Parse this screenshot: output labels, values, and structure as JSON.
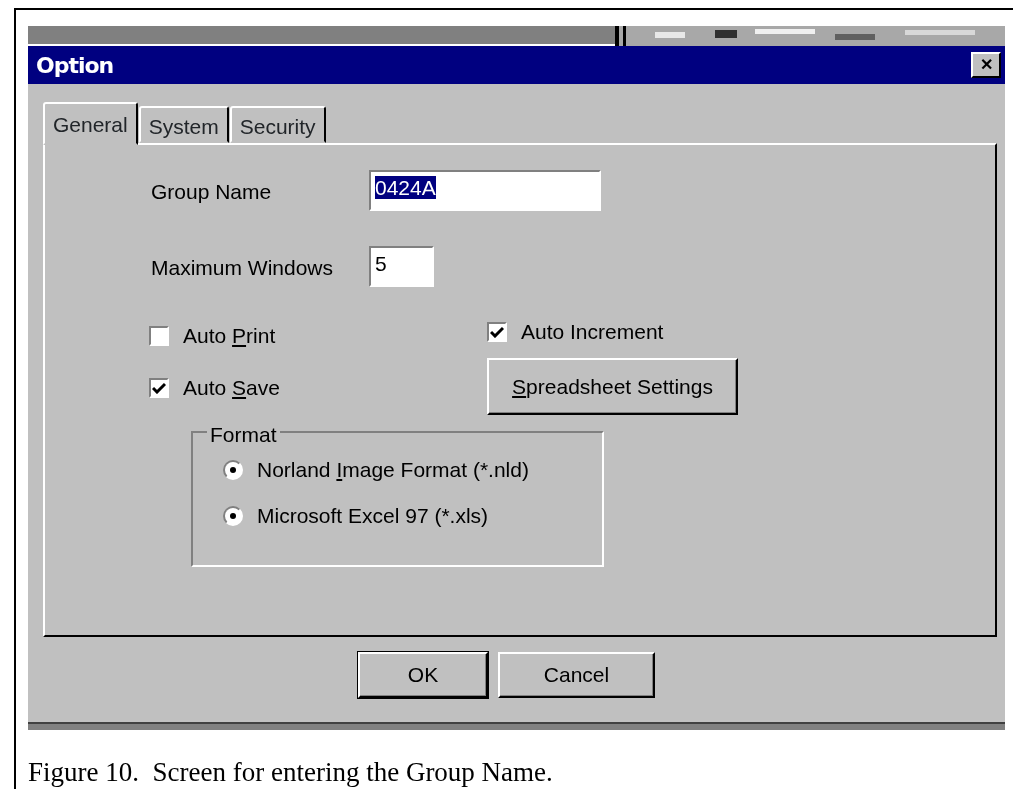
{
  "window": {
    "title": "Option",
    "close": "✕"
  },
  "tabs": [
    {
      "label": "General",
      "selected": true
    },
    {
      "label": "System",
      "selected": false
    },
    {
      "label": "Security",
      "selected": false
    }
  ],
  "fields": [
    {
      "label": "Group Name",
      "value": "0424A",
      "highlighted": true,
      "kind": "wide"
    },
    {
      "label": "Maximum Windows",
      "value": "5",
      "highlighted": false,
      "kind": "narrow"
    }
  ],
  "checkboxes_left": [
    {
      "before": "Auto ",
      "key": "P",
      "after": "rint",
      "checked": false
    },
    {
      "before": "Auto ",
      "key": "S",
      "after": "ave",
      "checked": true
    }
  ],
  "checkboxes_right": [
    {
      "before": "Auto Increment",
      "checked": true
    }
  ],
  "settings_button": {
    "key": "S",
    "after": "preadsheet Settings"
  },
  "format": {
    "legend": "Format",
    "options": [
      {
        "before": "Norland ",
        "key": "I",
        "after": "mage Format (*.nld)",
        "selected": true
      },
      {
        "before": "Microsoft Excel 97 (*.xls)",
        "selected": true
      }
    ]
  },
  "buttons": [
    {
      "label": "OK",
      "default": true
    },
    {
      "label": "Cancel",
      "default": false
    }
  ],
  "caption": "Figure 10.  Screen for entering the Group Name."
}
